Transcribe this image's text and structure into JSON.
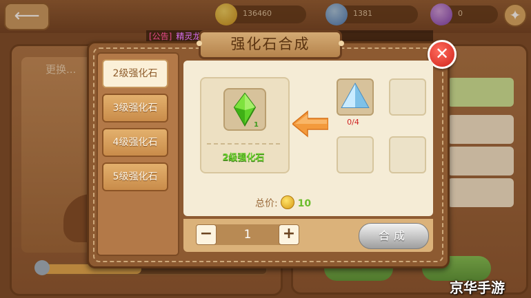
{
  "background": {
    "back_icon": "back-arrow-icon",
    "resources": [
      {
        "icon": "gold-coin-icon",
        "value": "136460",
        "color": "#f0c232"
      },
      {
        "icon": "blue-gem-icon",
        "value": "1381",
        "color": "#5fa7ea"
      },
      {
        "icon": "purple-gem-icon",
        "value": "0",
        "color": "#a462e2"
      }
    ],
    "panel_title": "更换...",
    "progress": 0.45
  },
  "announcement": {
    "tag": "[公告]",
    "author": "精灵龙"
  },
  "dialog": {
    "title": "强化石合成",
    "close_icon": "close-icon",
    "menu": [
      {
        "label": "2级强化石",
        "active": true
      },
      {
        "label": "3级强化石",
        "active": false
      },
      {
        "label": "4级强化石",
        "active": false
      },
      {
        "label": "5级强化石",
        "active": false
      }
    ],
    "target": {
      "name": "2级强化石",
      "quantity": "1",
      "icon": "green-crystal-icon"
    },
    "material": {
      "icon": "blue-crystal-icon",
      "count": "0/4"
    },
    "price": {
      "label": "总价:",
      "value": "10",
      "icon": "gold-coin-icon"
    },
    "stepper": {
      "minus": "−",
      "value": "1",
      "plus": "+"
    },
    "compose_label": "合成"
  },
  "watermark": "京华手游",
  "colors": {
    "accent_green": "#6bcf2e",
    "frame_brown": "#8d5a31",
    "close_red": "#d0231a"
  }
}
